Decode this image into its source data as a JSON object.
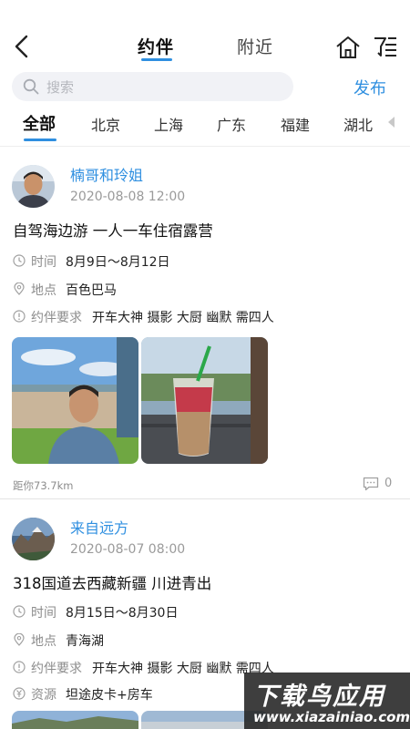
{
  "header": {
    "tabs": [
      {
        "label": "约伴",
        "active": true
      },
      {
        "label": "附近",
        "active": false
      }
    ],
    "icons": [
      "back-arrow-icon",
      "home-icon",
      "filter-icon"
    ]
  },
  "search": {
    "placeholder": "搜索",
    "publish_label": "发布"
  },
  "regions": {
    "items": [
      "全部",
      "北京",
      "上海",
      "广东",
      "福建",
      "湖北"
    ],
    "active": "全部"
  },
  "posts": [
    {
      "username": "楠哥和玲姐",
      "time": "2020-08-08 12:00",
      "title": "自驾海边游 一人一车住宿露营",
      "time_label": "时间",
      "time_value": "8月9日～8月12日",
      "location_label": "地点",
      "location_value": "百色巴马",
      "req_label": "约伴要求",
      "req_value": "开车大神 摄影 大厨 幽默 需四人",
      "distance": "距你73.7km",
      "comments": "0"
    },
    {
      "username": "来自远方",
      "time": "2020-08-07 08:00",
      "title": "318国道去西藏新疆 川进青出",
      "time_label": "时间",
      "time_value": "8月15日～8月30日",
      "location_label": "地点",
      "location_value": "青海湖",
      "req_label": "约伴要求",
      "req_value": "开车大神 摄影 大厨 幽默 需四人",
      "resource_label": "资源",
      "resource_value": "坦途皮卡+房车"
    }
  ],
  "watermark": {
    "title": "下载鸟应用",
    "url": "www.xiazainiao.com"
  },
  "colors": {
    "accent": "#2f8fe0",
    "secondary_text": "#8c8c8c"
  }
}
